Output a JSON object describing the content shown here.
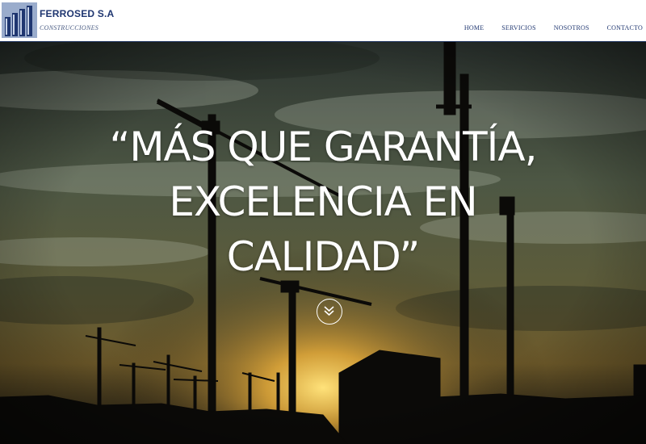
{
  "brand": {
    "name": "FERROSED S.A",
    "tagline": "CONSTRUCCIONES"
  },
  "nav": {
    "items": [
      "HOME",
      "SERVICIOS",
      "NOSOTROS",
      "CONTACTO"
    ]
  },
  "hero": {
    "headline_line1": "“MÁS QUE GARANTÍA,",
    "headline_line2": "EXCELENCIA EN",
    "headline_line3": "CALIDAD”",
    "scroll_icon": "double-chevron-down-icon"
  },
  "colors": {
    "brand_navy": "#1f3670",
    "nav_bg": "#ffffff",
    "sunset": "#f4c84a"
  }
}
